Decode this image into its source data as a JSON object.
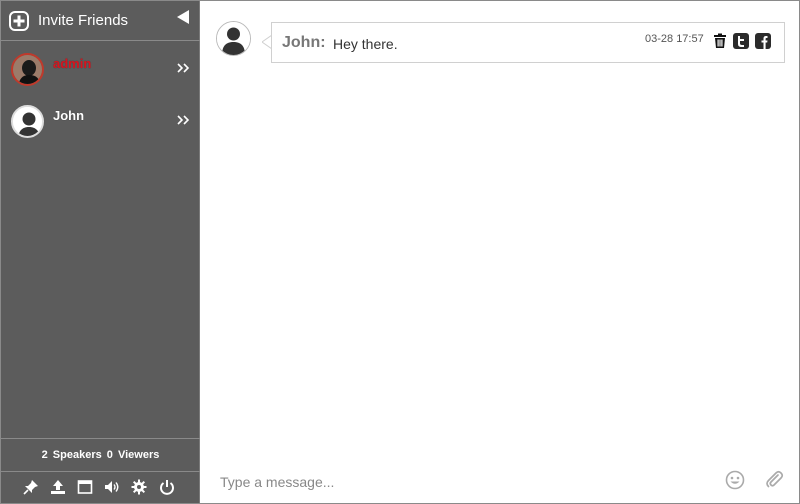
{
  "sidebar": {
    "invite_label": "Invite Friends",
    "users": [
      {
        "name": "admin",
        "name_color": "#d8141e",
        "avatar": "photo"
      },
      {
        "name": "John",
        "name_color": "#ffffff",
        "avatar": "default"
      }
    ],
    "stats": {
      "speakers_count": "2",
      "speakers_label": "Speakers",
      "viewers_count": "0",
      "viewers_label": "Viewers"
    },
    "toolbar": [
      "pin-icon",
      "upload-icon",
      "window-icon",
      "volume-icon",
      "gear-icon",
      "power-icon"
    ]
  },
  "chat": {
    "messages": [
      {
        "author": "John:",
        "text": "Hey there.",
        "time": "03-28 17:57"
      }
    ]
  },
  "composer": {
    "placeholder": "Type a message..."
  },
  "colors": {
    "sidebar_bg": "#5c5c5c",
    "admin_name": "#d8141e",
    "author_gray": "#777777"
  }
}
